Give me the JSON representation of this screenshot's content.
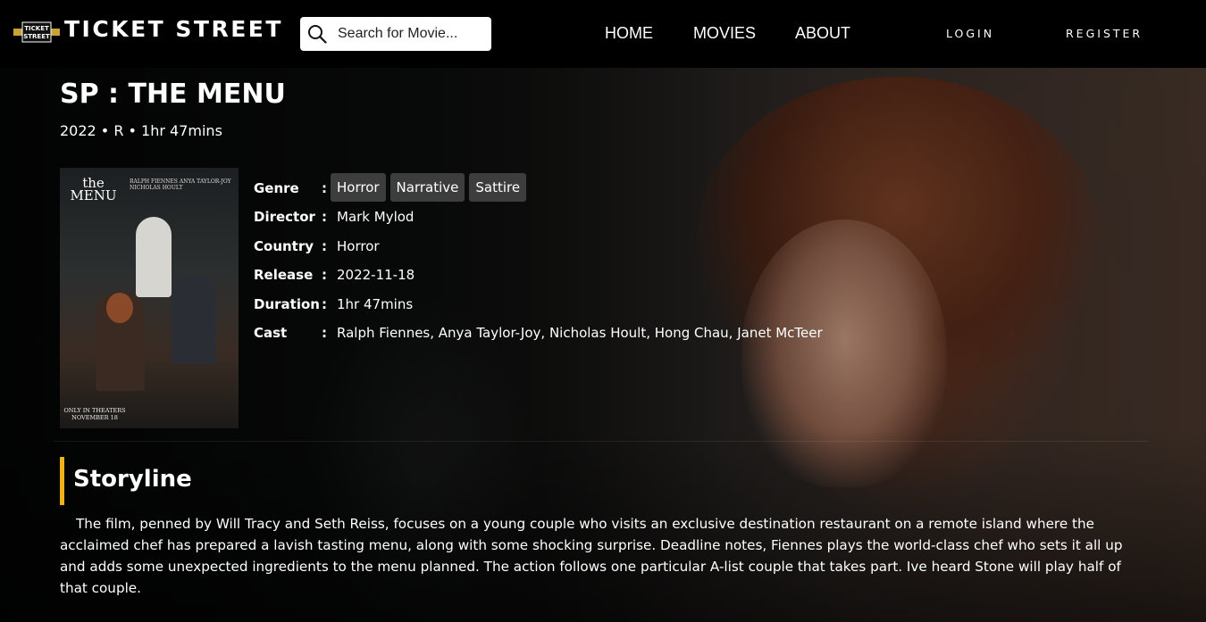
{
  "navbar": {
    "logo_text": "TICKET STREET",
    "logo_mark_text": "TICKET STREET",
    "search_placeholder": "Search for Movie...",
    "links": [
      "HOME",
      "MOVIES",
      "ABOUT"
    ],
    "login": "LOGIN",
    "register": "REGISTER"
  },
  "movie": {
    "title": "SP : THE MENU",
    "meta": "2022 • R • 1hr 47mins",
    "poster": {
      "title_line1": "the",
      "title_line2": "MENU",
      "cast": "RALPH FIENNES   ANYA TAYLOR-JOY   NICHOLAS HOULT",
      "footer": "ONLY IN THEATERS NOVEMBER 18"
    },
    "details": {
      "genre_label": "Genre",
      "genres": [
        "Horror",
        "Narrative",
        "Sattire"
      ],
      "director_label": "Director",
      "director": "Mark Mylod",
      "country_label": "Country",
      "country": "Horror",
      "release_label": "Release",
      "release": "2022-11-18",
      "duration_label": "Duration",
      "duration": "1hr 47mins",
      "cast_label": "Cast",
      "cast": "Ralph Fiennes, Anya Taylor-Joy, Nicholas Hoult, Hong Chau, Janet McTeer",
      "colon": ":"
    },
    "storyline_heading": "Storyline",
    "storyline": "The film, penned by Will Tracy and Seth Reiss, focuses on a young couple who visits an exclusive destination restaurant on a remote island where the acclaimed chef has prepared a lavish tasting menu, along with some shocking surprise. Deadline notes, Fiennes plays the world-class chef who sets it all up and adds some unexpected ingredients to the menu planned. The action follows one particular A-list couple that takes part. Ive heard Stone will play half of that couple."
  },
  "colors": {
    "accent": "#f0b21a",
    "tag_bg": "#3d3d3d",
    "nav_bg": "#000000"
  },
  "icons": {
    "search": "search-icon",
    "logo": "ticket-logo-icon"
  }
}
